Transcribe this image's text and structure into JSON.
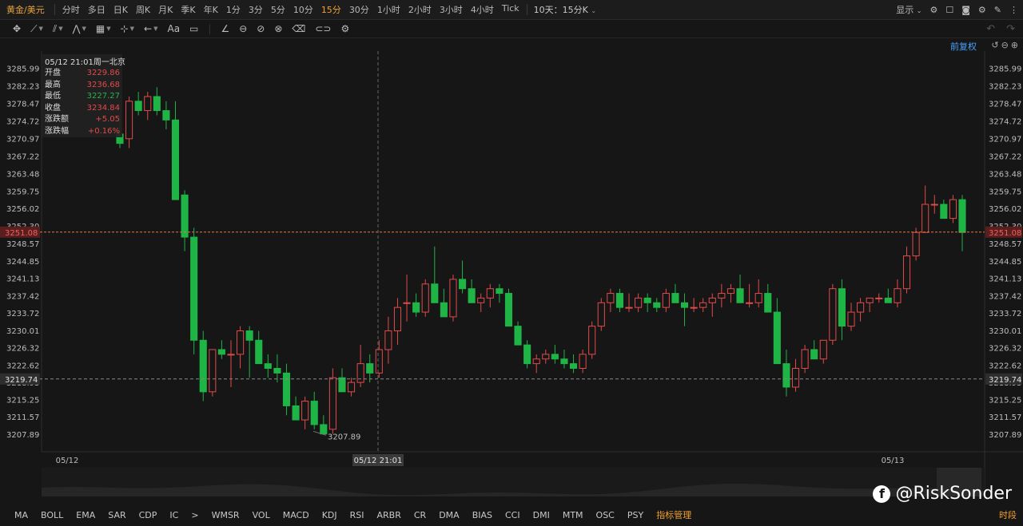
{
  "topbar": {
    "symbol": "黄金/美元",
    "periods": [
      "分时",
      "多日",
      "日K",
      "周K",
      "月K",
      "季K",
      "年K",
      "1分",
      "3分",
      "5分",
      "10分",
      "15分",
      "30分",
      "1小时",
      "2小时",
      "3小时",
      "4小时",
      "Tick"
    ],
    "active_period": "15分",
    "range_label": "10天：15分K",
    "display_label": "显示"
  },
  "toolbar": {
    "text_tool": "Aa"
  },
  "fuquan_label": "前复权",
  "info": {
    "header": "05/12 21:01周一北京",
    "rows": [
      {
        "k": "开盘",
        "v": "3229.86",
        "c": "up"
      },
      {
        "k": "最高",
        "v": "3236.68",
        "c": "up"
      },
      {
        "k": "最低",
        "v": "3227.27",
        "c": "dn"
      },
      {
        "k": "收盘",
        "v": "3234.84",
        "c": "up"
      },
      {
        "k": "涨跌额",
        "v": "+5.05",
        "c": "up"
      },
      {
        "k": "涨跌幅",
        "v": "+0.16%",
        "c": "up"
      }
    ]
  },
  "chart_data": {
    "type": "candlestick",
    "y_ticks": [
      "3285.99",
      "3282.23",
      "3278.47",
      "3274.72",
      "3270.97",
      "3267.22",
      "3263.48",
      "3259.75",
      "3256.02",
      "3252.30",
      "3248.57",
      "3244.85",
      "3241.13",
      "3237.42",
      "3233.72",
      "3230.01",
      "3226.32",
      "3222.62",
      "3218.93",
      "3215.25",
      "3211.57",
      "3207.89"
    ],
    "ylim": [
      3204.2,
      3289.7
    ],
    "current_price": "3251.08",
    "crosshair_price": "3219.74",
    "crosshair_time": "05/12 21:01",
    "min_label": "3207.89",
    "x_labels": [
      "05/12",
      "05/13"
    ],
    "candles": [
      [
        3272,
        3276,
        3269,
        3270
      ],
      [
        3271,
        3280,
        3269,
        3279
      ],
      [
        3279,
        3281,
        3276,
        3277
      ],
      [
        3277,
        3281,
        3275,
        3280
      ],
      [
        3280,
        3282,
        3276,
        3277
      ],
      [
        3277,
        3279,
        3273,
        3275
      ],
      [
        3275,
        3279,
        3258,
        3258
      ],
      [
        3259,
        3260,
        3247,
        3250
      ],
      [
        3250,
        3252,
        3225,
        3228
      ],
      [
        3228,
        3230,
        3215,
        3217
      ],
      [
        3217,
        3226,
        3216,
        3226
      ],
      [
        3226,
        3228,
        3224,
        3225
      ],
      [
        3225,
        3228,
        3218,
        3225
      ],
      [
        3225,
        3231,
        3222,
        3230
      ],
      [
        3230,
        3231,
        3220,
        3228
      ],
      [
        3228,
        3230,
        3223,
        3223
      ],
      [
        3223,
        3225,
        3220,
        3222
      ],
      [
        3222,
        3225,
        3219,
        3221
      ],
      [
        3221,
        3223,
        3212,
        3214
      ],
      [
        3214,
        3216,
        3211,
        3211
      ],
      [
        3211,
        3216,
        3209,
        3215
      ],
      [
        3215,
        3217,
        3209,
        3210
      ],
      [
        3210,
        3212,
        3208,
        3208
      ],
      [
        3209,
        3222,
        3208,
        3220
      ],
      [
        3220,
        3222,
        3217,
        3217
      ],
      [
        3217,
        3220,
        3216,
        3219
      ],
      [
        3219,
        3227,
        3218,
        3223
      ],
      [
        3223,
        3225,
        3219,
        3221
      ],
      [
        3221,
        3228,
        3220,
        3226
      ],
      [
        3226,
        3233,
        3223,
        3230
      ],
      [
        3230,
        3237,
        3227,
        3235
      ],
      [
        3236,
        3242,
        3232,
        3236
      ],
      [
        3236,
        3238,
        3233,
        3234
      ],
      [
        3234,
        3241,
        3233,
        3240
      ],
      [
        3240,
        3248,
        3237,
        3236
      ],
      [
        3236,
        3239,
        3233,
        3233
      ],
      [
        3233,
        3242,
        3232,
        3241
      ],
      [
        3241,
        3245,
        3238,
        3239
      ],
      [
        3239,
        3241,
        3236,
        3236
      ],
      [
        3236,
        3238,
        3234,
        3237
      ],
      [
        3237,
        3240,
        3235,
        3239
      ],
      [
        3239,
        3240,
        3236,
        3238
      ],
      [
        3238,
        3239,
        3231,
        3231
      ],
      [
        3231,
        3232,
        3227,
        3227
      ],
      [
        3227,
        3228,
        3222,
        3223
      ],
      [
        3223,
        3225,
        3221,
        3224
      ],
      [
        3224,
        3226,
        3223,
        3225
      ],
      [
        3225,
        3227,
        3223,
        3224
      ],
      [
        3224,
        3226,
        3222,
        3223
      ],
      [
        3223,
        3225,
        3221,
        3222
      ],
      [
        3222,
        3226,
        3221,
        3225
      ],
      [
        3225,
        3232,
        3224,
        3231
      ],
      [
        3231,
        3237,
        3230,
        3236
      ],
      [
        3236,
        3239,
        3234,
        3238
      ],
      [
        3238,
        3239,
        3234,
        3235
      ],
      [
        3235,
        3238,
        3234,
        3235
      ],
      [
        3235,
        3238,
        3234,
        3237
      ],
      [
        3237,
        3238,
        3234,
        3236
      ],
      [
        3236,
        3237,
        3234,
        3235
      ],
      [
        3235,
        3239,
        3234,
        3238
      ],
      [
        3238,
        3240,
        3236,
        3236
      ],
      [
        3236,
        3238,
        3231,
        3235
      ],
      [
        3235,
        3237,
        3234,
        3235
      ],
      [
        3235,
        3237,
        3234,
        3236
      ],
      [
        3236,
        3238,
        3233,
        3237
      ],
      [
        3237,
        3240,
        3235,
        3238
      ],
      [
        3238,
        3240,
        3236,
        3239
      ],
      [
        3239,
        3242,
        3236,
        3236
      ],
      [
        3236,
        3240,
        3235,
        3236
      ],
      [
        3236,
        3241,
        3235,
        3238
      ],
      [
        3238,
        3240,
        3234,
        3234
      ],
      [
        3234,
        3237,
        3223,
        3223
      ],
      [
        3223,
        3226,
        3216,
        3218
      ],
      [
        3218,
        3224,
        3217,
        3222
      ],
      [
        3222,
        3227,
        3221,
        3226
      ],
      [
        3226,
        3228,
        3224,
        3224
      ],
      [
        3224,
        3228,
        3223,
        3228
      ],
      [
        3228,
        3240,
        3227,
        3239
      ],
      [
        3239,
        3241,
        3228,
        3231
      ],
      [
        3231,
        3236,
        3230,
        3234
      ],
      [
        3234,
        3237,
        3232,
        3236
      ],
      [
        3236,
        3237,
        3234,
        3237
      ],
      [
        3237,
        3238,
        3236,
        3237
      ],
      [
        3237,
        3239,
        3236,
        3236
      ],
      [
        3236,
        3241,
        3235,
        3239
      ],
      [
        3239,
        3248,
        3238,
        3246
      ],
      [
        3246,
        3252,
        3245,
        3251
      ],
      [
        3251,
        3261,
        3251,
        3257
      ],
      [
        3257,
        3259,
        3255,
        3257
      ],
      [
        3257,
        3258,
        3254,
        3254
      ],
      [
        3254,
        3259,
        3253,
        3258
      ],
      [
        3258,
        3259,
        3247,
        3251
      ]
    ]
  },
  "bottombar": {
    "indicators": [
      "MA",
      "BOLL",
      "EMA",
      "SAR",
      "CDP",
      "IC",
      ">",
      "WMSR",
      "VOL",
      "MACD",
      "KDJ",
      "RSI",
      "ARBR",
      "CR",
      "DMA",
      "BIAS",
      "CCI",
      "DMI",
      "MTM",
      "OSC",
      "PSY"
    ],
    "manager": "指标管理",
    "shiduan": "时段"
  },
  "watermark": {
    "text": "@RiskSonder",
    "icon": "f"
  }
}
